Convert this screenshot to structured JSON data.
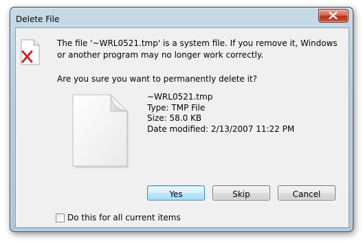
{
  "window": {
    "title": "Delete File",
    "close_icon": "close-icon"
  },
  "message": {
    "line1": "The file '~WRL0521.tmp' is a system file. If you remove it, Windows or another program may no longer work correctly.",
    "question": "Are you sure you want to permanently delete it?"
  },
  "file": {
    "name": "~WRL0521.tmp",
    "type": "Type: TMP File",
    "size": "Size: 58.0 KB",
    "modified": "Date modified: 2/13/2007 11:22 PM",
    "icon": "file-icon"
  },
  "buttons": {
    "yes": "Yes",
    "skip": "Skip",
    "cancel": "Cancel"
  },
  "option": {
    "label": "Do this for all current items",
    "checked": false
  },
  "colors": {
    "frame": "#b7cddb",
    "close_button": "#c9553c",
    "default_button_border": "#3c7fb1",
    "warning_x": "#d0202a"
  }
}
